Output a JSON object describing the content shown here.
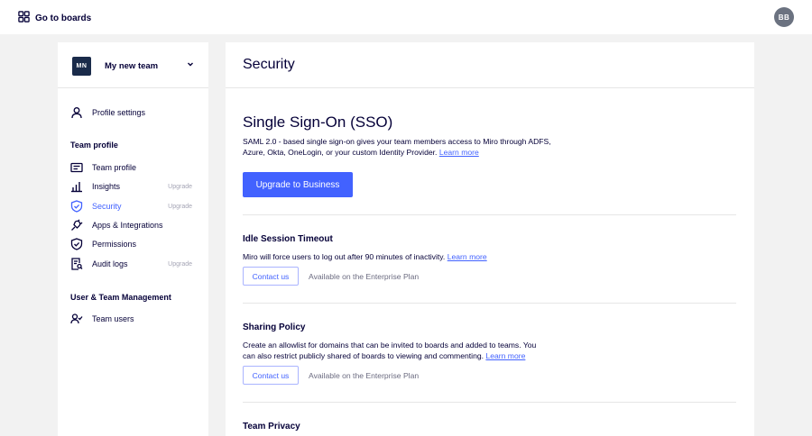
{
  "topbar": {
    "goto_label": "Go to boards",
    "avatar_initials": "BB"
  },
  "sidebar": {
    "team_initials": "MN",
    "team_name": "My new team",
    "profile_settings": "Profile settings",
    "team_profile_heading": "Team profile",
    "items": [
      {
        "label": "Team profile",
        "icon": "id-card-icon",
        "badge": ""
      },
      {
        "label": "Insights",
        "icon": "bar-chart-icon",
        "badge": "Upgrade"
      },
      {
        "label": "Security",
        "icon": "shield-icon",
        "badge": "Upgrade"
      },
      {
        "label": "Apps & Integrations",
        "icon": "plug-icon",
        "badge": ""
      },
      {
        "label": "Permissions",
        "icon": "shield-check-icon",
        "badge": ""
      },
      {
        "label": "Audit logs",
        "icon": "audit-log-icon",
        "badge": "Upgrade"
      }
    ],
    "user_mgmt_heading": "User & Team Management",
    "team_users": "Team users"
  },
  "main": {
    "title": "Security",
    "sso": {
      "title": "Single Sign-On (SSO)",
      "description": "SAML 2.0 - based single sign-on gives your team members access to Miro through ADFS, Azure, Okta, OneLogin, or your custom Identity Provider.",
      "learn_more": "Learn more",
      "button": "Upgrade to Business"
    },
    "idle": {
      "title": "Idle Session Timeout",
      "description": "Miro will force users to log out after 90 minutes of inactivity.",
      "learn_more": "Learn more",
      "button": "Contact us",
      "availability": "Available on the Enterprise Plan"
    },
    "sharing": {
      "title": "Sharing Policy",
      "description": "Create an allowlist for domains that can be invited to boards and added to teams. You can also restrict publicly shared of boards to viewing and commenting.",
      "learn_more": "Learn more",
      "button": "Contact us",
      "availability": "Available on the Enterprise Plan"
    },
    "privacy": {
      "title": "Team Privacy"
    }
  },
  "colors": {
    "accent": "#4262ff",
    "text": "#050038",
    "page_bg": "#f2f2f2"
  }
}
